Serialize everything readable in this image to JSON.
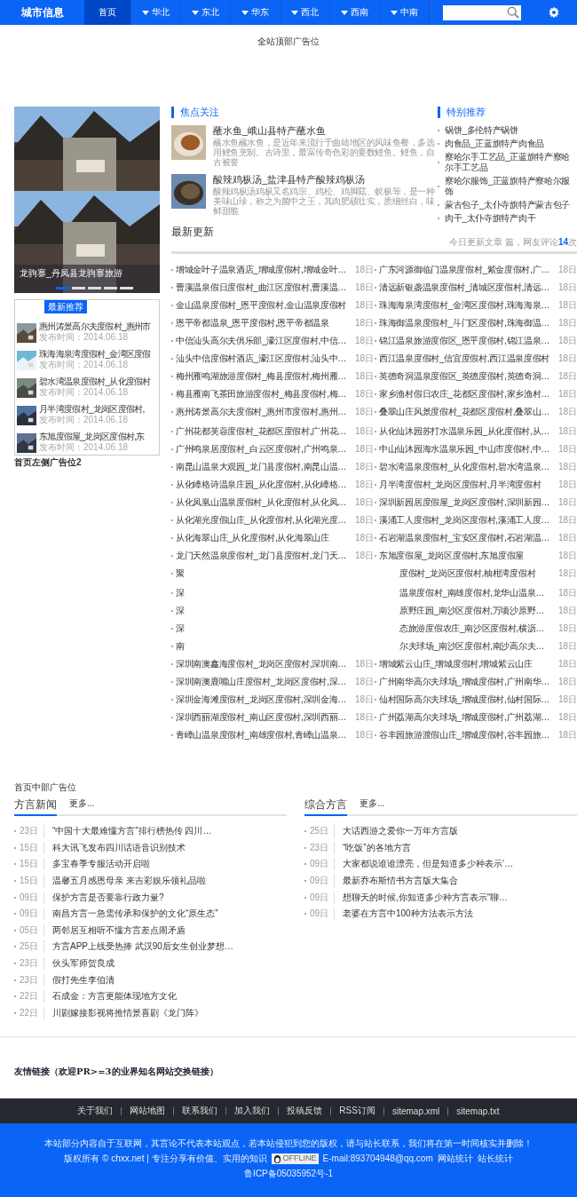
{
  "nav": {
    "logo": "城市信息",
    "tabs": [
      {
        "label": "首页",
        "selected": true,
        "dropdown": false
      },
      {
        "label": "华北",
        "selected": false,
        "dropdown": true
      },
      {
        "label": "东北",
        "selected": false,
        "dropdown": true
      },
      {
        "label": "华东",
        "selected": false,
        "dropdown": true
      },
      {
        "label": "西北",
        "selected": false,
        "dropdown": true
      },
      {
        "label": "西南",
        "selected": false,
        "dropdown": true
      },
      {
        "label": "中南",
        "selected": false,
        "dropdown": true
      }
    ]
  },
  "top_ad": "全站顶部广告位",
  "slider": {
    "caption": "龙驹寨_丹凤县龙驹寨旅游",
    "dots": [
      {
        "selected": true
      },
      {
        "selected": false
      },
      {
        "selected": false
      },
      {
        "selected": false
      },
      {
        "selected": false
      }
    ]
  },
  "latest_recommend": {
    "tab": "最新推荐",
    "items": [
      {
        "title": "惠州涛景高尔夫度假村_惠州市",
        "time": "发布时间：2014.06.18"
      },
      {
        "title": "珠海海泉湾度假村_金湾区度假",
        "time": "发布时间：2014.06.18"
      },
      {
        "title": "碧水湾温泉度假村_从化度假村",
        "time": "发布时间：2014.06.18"
      },
      {
        "title": "月半湾度假村_龙岗区度假村,",
        "time": "发布时间：2014.06.18"
      },
      {
        "title": "东旭度假屋_龙岗区度假村,东",
        "time": "发布时间：2014.06.18"
      }
    ]
  },
  "left_ad": "首页左侧广告位2",
  "focus": {
    "title": "焦点关注",
    "items": [
      {
        "title": "蘸水鱼_峨山县特产蘸水鱼",
        "desc": "蘸水鱼蘸水鱼，是近年来流行于曲靖地区的风味鱼餐，多选用鲤鱼烹制。古诗里，最富传奇色彩的要数鲤鱼。鲤鱼，自古被誉"
      },
      {
        "title": "酸辣鸡枞汤_盐津县特产酸辣鸡枞汤",
        "desc": "酸辣鸡枞汤鸡枞又名鸡宗、鸡松、鸡脚菇、蚁枞等，是一种美味山珍，称之为菌中之王，其肉肥硕壮实，质细丝白，味鲜甜脆"
      }
    ]
  },
  "special": {
    "title": "特别推荐",
    "items": [
      "锅饼_多伦特产锅饼",
      "肉食品_正蓝旗特产肉食品",
      "察哈尔手工艺品_正蓝旗特产察哈尔手工艺品",
      "察哈尔服饰_正蓝旗特产察哈尔服饰",
      "蒙古包子_太仆寺旗特产蒙古包子",
      "肉干_太仆寺旗特产肉干"
    ]
  },
  "latest": {
    "title": "最新更新",
    "stats_before": "今日更新文章 篇，网友评论",
    "stats_count": "14",
    "stats_after": "次"
  },
  "updates": [
    {
      "left": [
        {
          "kind": "full",
          "title": "增城金叶子温泉酒店_增城度假村,增城金叶…",
          "date": "18日"
        },
        {
          "kind": "full",
          "title": "曹溪温泉假日度假村_曲江区度假村,曹溪温…",
          "date": "18日"
        },
        {
          "kind": "full",
          "title": "金山温泉度假村_恩平度假村,金山温泉度假村",
          "date": "18日"
        },
        {
          "kind": "full",
          "title": "恩平帝都温泉_恩平度假村,恩平帝都温泉",
          "date": "18日"
        },
        {
          "kind": "full",
          "title": "中信汕头高尔夫俱乐部_濠江区度假村,中信…",
          "date": "18日"
        },
        {
          "kind": "full",
          "title": "汕头中信度假村酒店_濠江区度假村,汕头中…",
          "date": "18日"
        },
        {
          "kind": "full",
          "title": "梅州雁鸣湖旅游度假村_梅县度假村,梅州雁…",
          "date": "18日"
        },
        {
          "kind": "full",
          "title": "梅县雁南飞茶田旅游度假村_梅县度假村,梅…",
          "date": "18日"
        },
        {
          "kind": "full",
          "title": "惠州涛景高尔夫度假村_惠州市度假村,惠州…",
          "date": "18日"
        }
      ],
      "right": [
        {
          "kind": "full",
          "title": "广东河源御临门温泉度假村_紫金度假村,广…",
          "date": "18日"
        },
        {
          "kind": "full",
          "title": "清远新银盏温泉度假村_清城区度假村,清远…",
          "date": "18日"
        },
        {
          "kind": "full",
          "title": "珠海海泉湾度假村_金湾区度假村,珠海海泉…",
          "date": "18日"
        },
        {
          "kind": "full",
          "title": "珠海御温泉度假村_斗门区度假村,珠海御温…",
          "date": "18日"
        },
        {
          "kind": "full",
          "title": "锦江温泉旅游度假区_恩平度假村,锦江温泉…",
          "date": "18日"
        },
        {
          "kind": "full",
          "title": "西江温泉度假村_信宜度假村,西江温泉度假村",
          "date": "18日"
        },
        {
          "kind": "full",
          "title": "英德奇洞温泉度假区_英德度假村,英德奇洞…",
          "date": "18日"
        },
        {
          "kind": "full",
          "title": "家乡渔村假日农庄_花都区度假村,家乡渔村…",
          "date": "18日"
        },
        {
          "kind": "full",
          "title": "叠翠山庄风景度假村_花都区度假村,叠翠山…",
          "date": "18日"
        }
      ]
    },
    {
      "left": [
        {
          "kind": "full",
          "title": "广州花都芙蓉度假村_花都区度假村,广州花…",
          "date": "18日"
        },
        {
          "kind": "full",
          "title": "广州鸣泉居度假村_白云区度假村,广州鸣泉…",
          "date": "18日"
        },
        {
          "kind": "full",
          "title": "南昆山温泉大观园_龙门县度假村,南昆山温…",
          "date": "18日"
        },
        {
          "kind": "full",
          "title": "从化嶂格诗温泉庄园_从化度假村,从化嶂格…",
          "date": "18日"
        },
        {
          "kind": "full",
          "title": "从化凤凰山温泉度假村_从化度假村,从化凤…",
          "date": "18日"
        },
        {
          "kind": "full",
          "title": "从化湖光度假山庄_从化度假村,从化湖光度…",
          "date": "18日"
        },
        {
          "kind": "full",
          "title": "从化海翠山庄_从化度假村,从化海翠山庄",
          "date": "18日"
        },
        {
          "kind": "full",
          "title": "龙门天然温泉度假村_龙门县度假村,龙门天…",
          "date": "18日"
        },
        {
          "kind": "cut_end",
          "title": "聚"
        }
      ],
      "right": [
        {
          "kind": "full",
          "title": "从化仙沐园苏打水温泉乐园_从化度假村,从…",
          "date": "18日"
        },
        {
          "kind": "full",
          "title": "中山仙沐园海水温泉乐园_中山市度假村,中…",
          "date": "18日"
        },
        {
          "kind": "full",
          "title": "碧水湾温泉度假村_从化度假村,碧水湾温泉…",
          "date": "18日"
        },
        {
          "kind": "full",
          "title": "月半湾度假村_龙岗区度假村,月半湾度假村",
          "date": "18日"
        },
        {
          "kind": "full",
          "title": "深圳新园居度假屋_龙岗区度假村,深圳新园…",
          "date": "18日"
        },
        {
          "kind": "full",
          "title": "溪涌工人度假村_龙岗区度假村,溪涌工人度…",
          "date": "18日"
        },
        {
          "kind": "full",
          "title": "石岩湖温泉度假村_宝安区度假村,石岩湖温…",
          "date": "18日"
        },
        {
          "kind": "full",
          "title": "东旭度假屋_龙岗区度假村,东旭度假屋",
          "date": "18日"
        },
        {
          "kind": "cut_start",
          "title": "度假村_龙岗区度假村,柚柑湾度假村",
          "date": "18日"
        }
      ]
    },
    {
      "left": [
        {
          "kind": "cut_end",
          "title": "深"
        },
        {
          "kind": "cut_end",
          "title": "深"
        },
        {
          "kind": "cut_end",
          "title": "深"
        },
        {
          "kind": "cut_end",
          "title": "南"
        },
        {
          "kind": "full",
          "title": "深圳南澳鑫海度假村_龙岗区度假村,深圳南…",
          "date": "18日"
        },
        {
          "kind": "full",
          "title": "深圳南澳鹿嘴山庄度假村_龙岗区度假村,深…",
          "date": "18日"
        },
        {
          "kind": "full",
          "title": "深圳金海滩度假村_龙岗区度假村,深圳金海…",
          "date": "18日"
        },
        {
          "kind": "full",
          "title": "深圳西丽湖度假村_南山区度假村,深圳西丽…",
          "date": "18日"
        },
        {
          "kind": "full",
          "title": "青嶂山温泉度假村_南雄度假村,青嶂山温泉…",
          "date": "18日"
        }
      ],
      "right": [
        {
          "kind": "cut_start",
          "title": "温泉度假村_南雄度假村,龙华山温泉…",
          "date": "18日"
        },
        {
          "kind": "cut_start",
          "title": "原野庄园_南沙区度假村,万顷沙原野…",
          "date": "18日"
        },
        {
          "kind": "cut_start",
          "title": "态旅游度假农庄_南沙区度假村,横沥…",
          "date": "18日"
        },
        {
          "kind": "cut_start",
          "title": "尔夫球场_南沙区度假村,南沙高尔夫…",
          "date": "18日"
        },
        {
          "kind": "full",
          "title": "增城紫云山庄_增城度假村,增城紫云山庄",
          "date": "18日"
        },
        {
          "kind": "full",
          "title": "广州南华高尔夫球场_增城度假村,广州南华…",
          "date": "18日"
        },
        {
          "kind": "full",
          "title": "仙村国际高尔夫球场_增城度假村,仙村国际…",
          "date": "18日"
        },
        {
          "kind": "full",
          "title": "广州荔湖高尔夫球场_增城度假村,广州荔湖…",
          "date": "18日"
        },
        {
          "kind": "full",
          "title": "谷丰园旅游渡假山庄_增城度假村,谷丰园旅…",
          "date": "18日"
        }
      ]
    }
  ],
  "mid_ad": "首页中部广告位",
  "news_sections": [
    {
      "title": "方言新闻",
      "more": "更多...",
      "items": [
        {
          "date": "23日",
          "title": "“中国十大最难懂方言”排行榜热传 四川…"
        },
        {
          "date": "15日",
          "title": "科大讯飞发布四川话语音识别技术"
        },
        {
          "date": "15日",
          "title": "多宝春季专服活动开启啦"
        },
        {
          "date": "15日",
          "title": "温馨五月感恩母亲 来吉彩娱乐领礼品啦"
        },
        {
          "date": "09日",
          "title": "保护方言是否要靠行政力量?"
        },
        {
          "date": "09日",
          "title": "南昌方言一急需传承和保护的文化“原生态”"
        },
        {
          "date": "05日",
          "title": "两邻居互相听不懂方言差点闹矛盾"
        },
        {
          "date": "25日",
          "title": "方言APP上线受热捧 武汉90后女生创业梦想…"
        },
        {
          "date": "23日",
          "title": "伙头军师贺良成"
        },
        {
          "date": "23日",
          "title": "假打先生李伯清"
        },
        {
          "date": "22日",
          "title": "石成金：方言更能体现地方文化"
        },
        {
          "date": "22日",
          "title": "川剧嫁接影视将推情景喜剧《龙门阵》"
        }
      ]
    },
    {
      "title": "综合方言",
      "more": "更多...",
      "items": [
        {
          "date": "25日",
          "title": "大话西游之爱你一万年方言版"
        },
        {
          "date": "23日",
          "title": "“吃饭”的各地方言"
        },
        {
          "date": "09日",
          "title": "大家都说谁谁漂亮，但是知道多少种表示‘…"
        },
        {
          "date": "09日",
          "title": "最新乔布斯情书方言版大集合"
        },
        {
          "date": "09日",
          "title": "想聊天的时候,你知道多少种方言表示“聊…"
        },
        {
          "date": "09日",
          "title": "老婆在方言中100种方法表示方法"
        }
      ]
    }
  ],
  "friend_links": "友情链接（欢迎PR>=3的业界知名网站交换链接）",
  "footer_links": [
    "关于我们",
    "网站地图",
    "联系我们",
    "加入我们",
    "投稿反馈",
    "RSS订阅",
    "sitemap.xml",
    "sitemap.txt"
  ],
  "footer": {
    "notice": "本站部分内容自于互联网，其言论不代表本站观点，若本站侵犯到您的版权，请与站长联系，我们将在第一时间核实并删除！",
    "copyright": "版权所有 © chxx.net | 专注分享有价值、实用的知识",
    "qq_status": "OFFLINE",
    "email": "E-mail:893704948@qq.com",
    "stats_links": [
      "网站统计",
      "站长统计"
    ],
    "icp": "鲁ICP备05035952号-1"
  }
}
